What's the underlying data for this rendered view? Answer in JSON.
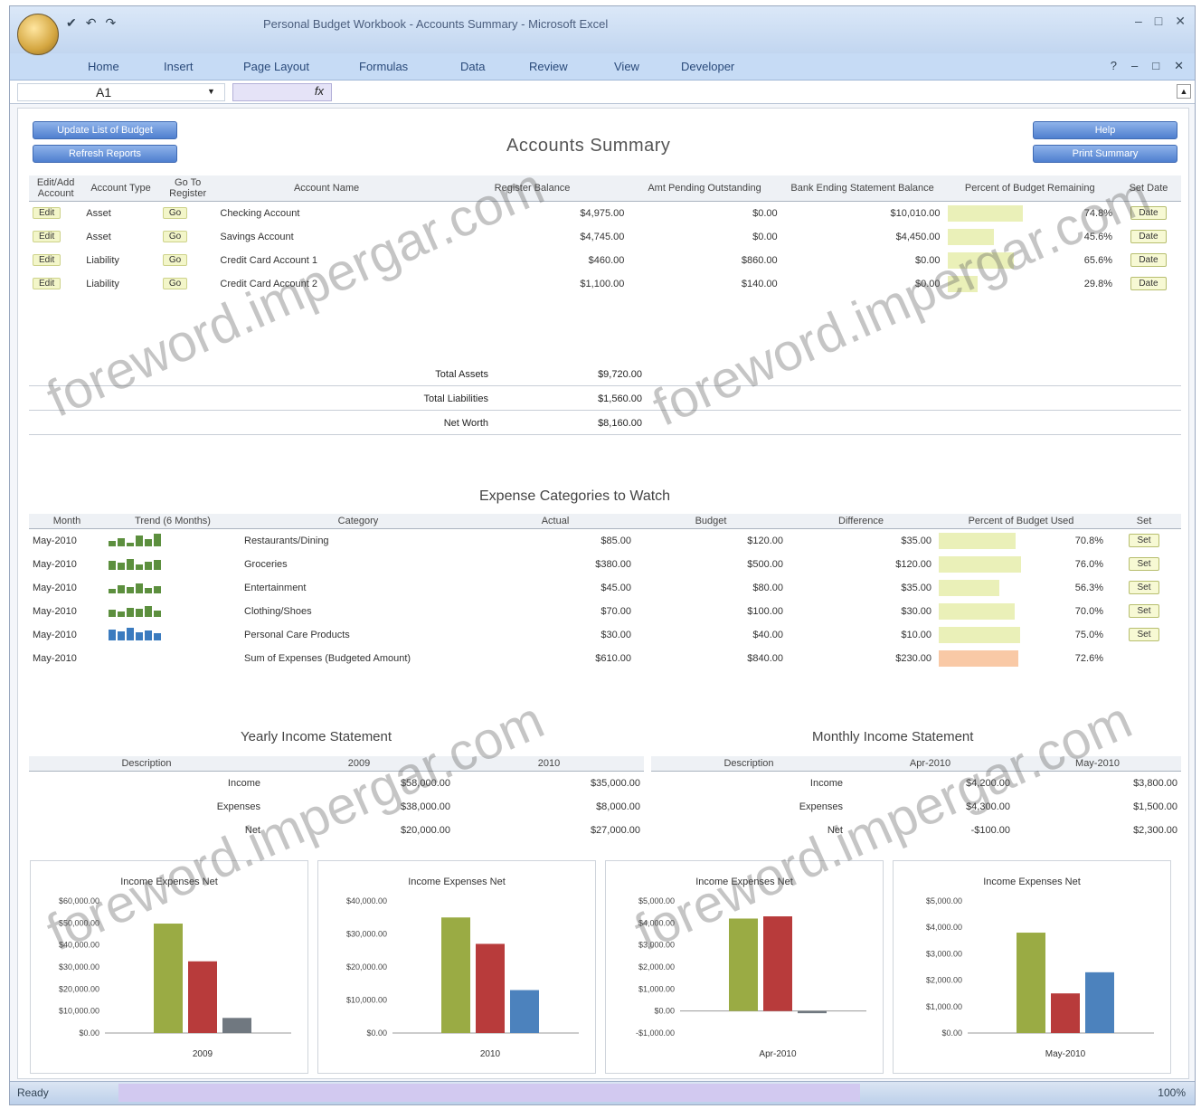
{
  "app": {
    "title": "Personal Budget Workbook - Accounts Summary - Microsoft Excel",
    "quick_access": [
      "✔",
      "↶",
      "↷"
    ],
    "window_controls": [
      "–",
      "□",
      "✕"
    ]
  },
  "ribbon": {
    "tabs": [
      "Home",
      "Insert",
      "Page Layout",
      "Formulas",
      "Data",
      "Review",
      "View",
      "Developer"
    ],
    "help": "?"
  },
  "formula_bar": {
    "cell": "A1",
    "fx": "fx"
  },
  "buttons": {
    "update": "Update List of Budget",
    "refresh": "Refresh Reports",
    "help": "Help",
    "print": "Print Summary"
  },
  "accounts": {
    "title": "Accounts Summary",
    "headers": [
      "Edit/Add Account",
      "Account Type",
      "Go To Register",
      "Account Name",
      "Register Balance",
      "Amt Pending Outstanding",
      "Bank Ending Statement Balance",
      "Percent of Budget Remaining",
      "Set Date"
    ],
    "rows": [
      {
        "edit": "Edit",
        "type": "Asset",
        "go": "Go",
        "name": "Checking Account",
        "balance": "$4,975.00",
        "pending": "$0.00",
        "bank": "$10,010.00",
        "pct": "74.8%",
        "pct_value": 0.75,
        "date": "Date"
      },
      {
        "edit": "Edit",
        "type": "Asset",
        "go": "Go",
        "name": "Savings Account",
        "balance": "$4,745.00",
        "pending": "$0.00",
        "bank": "$4,450.00",
        "pct": "45.6%",
        "pct_value": 0.46,
        "date": "Date"
      },
      {
        "edit": "Edit",
        "type": "Liability",
        "go": "Go",
        "name": "Credit Card Account 1",
        "balance": "$460.00",
        "pending": "$860.00",
        "bank": "$0.00",
        "pct": "65.6%",
        "pct_value": 0.66,
        "date": "Date"
      },
      {
        "edit": "Edit",
        "type": "Liability",
        "go": "Go",
        "name": "Credit Card Account 2",
        "balance": "$1,100.00",
        "pending": "$140.00",
        "bank": "$0.00",
        "pct": "29.8%",
        "pct_value": 0.3,
        "date": "Date"
      }
    ],
    "totals": [
      {
        "label": "Total Assets",
        "value": "$9,720.00"
      },
      {
        "label": "Total Liabilities",
        "value": "$1,560.00"
      },
      {
        "label": "Net Worth",
        "value": "$8,160.00"
      }
    ]
  },
  "expenses": {
    "title": "Expense Categories to Watch",
    "headers": [
      "Month",
      "Trend (6 Months)",
      "Category",
      "Actual",
      "Budget",
      "Difference",
      "Percent of Budget Used",
      "Set"
    ],
    "rows": [
      {
        "month": "May-2010",
        "cat": "Restaurants/Dining",
        "actual": "$85.00",
        "budget": "$120.00",
        "diff": "$35.00",
        "pct": "70.8%",
        "pct_value": 0.71,
        "set": "Set"
      },
      {
        "month": "May-2010",
        "cat": "Groceries",
        "actual": "$380.00",
        "budget": "$500.00",
        "diff": "$120.00",
        "pct": "76.0%",
        "pct_value": 0.76,
        "set": "Set"
      },
      {
        "month": "May-2010",
        "cat": "Entertainment",
        "actual": "$45.00",
        "budget": "$80.00",
        "diff": "$35.00",
        "pct": "56.3%",
        "pct_value": 0.56,
        "set": "Set"
      },
      {
        "month": "May-2010",
        "cat": "Clothing/Shoes",
        "actual": "$70.00",
        "budget": "$100.00",
        "diff": "$30.00",
        "pct": "70.0%",
        "pct_value": 0.7,
        "set": "Set"
      },
      {
        "month": "May-2010",
        "cat": "Personal Care Products",
        "actual": "$30.00",
        "budget": "$40.00",
        "diff": "$10.00",
        "pct": "75.0%",
        "pct_value": 0.75,
        "set": "Set"
      },
      {
        "month": "May-2010",
        "cat": "Sum of Expenses (Budgeted Amount)",
        "actual": "$610.00",
        "budget": "$840.00",
        "diff": "$230.00",
        "pct": "72.6%",
        "pct_value": 0.73,
        "set": ""
      }
    ]
  },
  "yearly": {
    "title": "Yearly Income Statement",
    "headers": [
      "Description",
      "2009",
      "2010"
    ],
    "rows": [
      {
        "desc": "Income",
        "a": "$58,000.00",
        "b": "$35,000.00"
      },
      {
        "desc": "Expenses",
        "a": "$38,000.00",
        "b": "$8,000.00"
      },
      {
        "desc": "Net",
        "a": "$20,000.00",
        "b": "$27,000.00"
      }
    ]
  },
  "monthly": {
    "title": "Monthly Income Statement",
    "headers": [
      "Description",
      "Apr-2010",
      "May-2010"
    ],
    "rows": [
      {
        "desc": "Income",
        "a": "$4,200.00",
        "b": "$3,800.00"
      },
      {
        "desc": "Expenses",
        "a": "$4,300.00",
        "b": "$1,500.00"
      },
      {
        "desc": "Net",
        "a": "-$100.00",
        "b": "$2,300.00"
      }
    ]
  },
  "colors": {
    "income": "#9aab44",
    "expenses": "#b83b3b",
    "net": "#4c82bd",
    "net_neg": "#707880"
  },
  "chart_data": [
    {
      "type": "bar",
      "title": "Income Expenses Net",
      "categories": [
        "2009"
      ],
      "series": [
        {
          "name": "Income",
          "values": [
            58000
          ]
        },
        {
          "name": "Expenses",
          "values": [
            38000
          ]
        },
        {
          "name": "Net",
          "values": [
            8000
          ]
        }
      ],
      "ylim": [
        0,
        70000
      ],
      "yticks": [
        "$0.00",
        "$10,000.00",
        "$20,000.00",
        "$30,000.00",
        "$40,000.00",
        "$50,000.00",
        "$60,000.00"
      ]
    },
    {
      "type": "bar",
      "title": "Income Expenses Net",
      "categories": [
        "2010"
      ],
      "series": [
        {
          "name": "Income",
          "values": [
            35000
          ]
        },
        {
          "name": "Expenses",
          "values": [
            27000
          ]
        },
        {
          "name": "Net",
          "values": [
            13000
          ]
        }
      ],
      "ylim": [
        0,
        40000
      ],
      "yticks": [
        "$0.00",
        "$10,000.00",
        "$20,000.00",
        "$30,000.00",
        "$40,000.00"
      ]
    },
    {
      "type": "bar",
      "title": "Income Expenses Net",
      "categories": [
        "Apr-2010"
      ],
      "series": [
        {
          "name": "Income",
          "values": [
            4200
          ]
        },
        {
          "name": "Expenses",
          "values": [
            4300
          ]
        },
        {
          "name": "Net",
          "values": [
            -100
          ]
        }
      ],
      "ylim": [
        -1000,
        5000
      ],
      "yticks": [
        "-$1,000.00",
        "$0.00",
        "$1,000.00",
        "$2,000.00",
        "$3,000.00",
        "$4,000.00",
        "$5,000.00"
      ]
    },
    {
      "type": "bar",
      "title": "Income Expenses Net",
      "categories": [
        "May-2010"
      ],
      "series": [
        {
          "name": "Income",
          "values": [
            3800
          ]
        },
        {
          "name": "Expenses",
          "values": [
            1500
          ]
        },
        {
          "name": "Net",
          "values": [
            2300
          ]
        }
      ],
      "ylim": [
        0,
        5000
      ],
      "yticks": [
        "$0.00",
        "$1,000.00",
        "$2,000.00",
        "$3,000.00",
        "$4,000.00",
        "$5,000.00"
      ]
    }
  ],
  "status": {
    "ready": "Ready",
    "zoom": "100%"
  },
  "watermark": "foreword.impergar.com"
}
